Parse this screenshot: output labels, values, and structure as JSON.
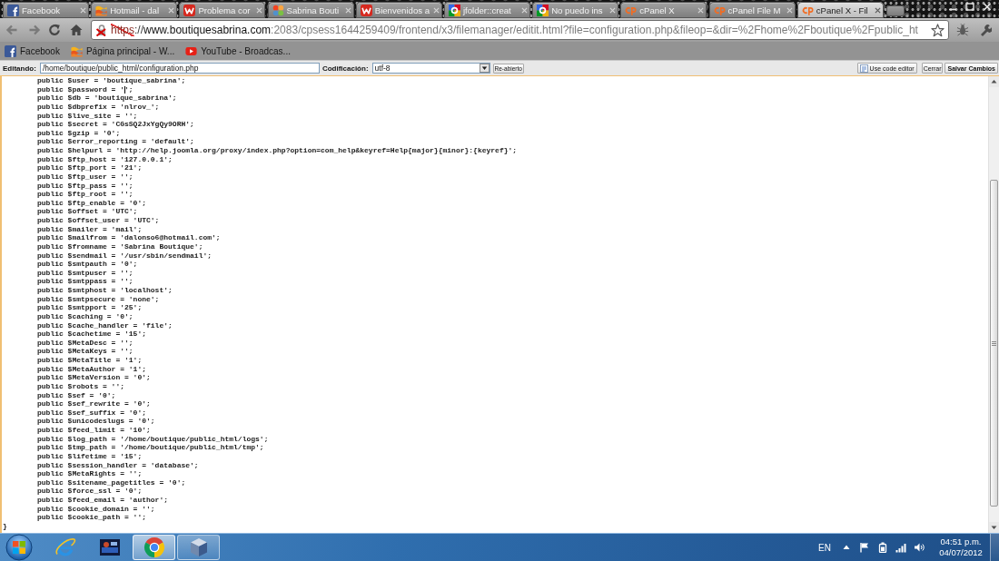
{
  "browser": {
    "tabs": [
      {
        "title": "Facebook",
        "kind": "facebook",
        "selected": false
      },
      {
        "title": "Hotmail - dal",
        "kind": "hotmail",
        "selected": false
      },
      {
        "title": "Problema cor",
        "kind": "w",
        "selected": false
      },
      {
        "title": "Sabrina Bouti",
        "kind": "joomla",
        "selected": false
      },
      {
        "title": "Bienvenidos a",
        "kind": "w",
        "selected": false
      },
      {
        "title": "jfolder::creat",
        "kind": "google",
        "selected": false
      },
      {
        "title": "No puedo ins",
        "kind": "google",
        "selected": false
      },
      {
        "title": "cPanel X",
        "kind": "cpanel",
        "selected": false
      },
      {
        "title": "cPanel File M",
        "kind": "cpanel",
        "selected": false
      },
      {
        "title": "cPanel X - Fil",
        "kind": "cpanel",
        "selected": true
      }
    ],
    "certificate_error": true,
    "url": {
      "scheme": "https",
      "separator": "://",
      "host": "www.boutiquesabrina.com",
      "path": ":2083/cpsess1644259409/frontend/x3/filemanager/editit.html?file=configuration.php&fileop=&dir=%2Fhome%2Fboutique%2Fpublic_ht"
    },
    "bookmarks": [
      {
        "label": "Facebook",
        "kind": "facebook"
      },
      {
        "label": "Página principal - W...",
        "kind": "hotmail"
      },
      {
        "label": "YouTube - Broadcas...",
        "kind": "youtube"
      }
    ]
  },
  "editor": {
    "path_label": "Editando:",
    "path": "/home/boutique/public_html/configuration.php",
    "encoding_label": "Codificación:",
    "encoding": "utf-8",
    "reopen_button": "Re-abierto",
    "code_editor_button": "Use code editor",
    "close_button": "Cerrar",
    "save_button": "Salvar Cambios",
    "lines": [
      {
        "text": "public $user = 'boutique_sabrina';",
        "cursor": false
      },
      {
        "text": "public $password = '",
        "cursor": true,
        "text_after_cursor": "';"
      },
      {
        "text": "public $db = 'boutique_sabrina';",
        "cursor": false
      },
      {
        "text": "public $dbprefix = 'nlrov_';",
        "cursor": false
      },
      {
        "text": "public $live_site = '';",
        "cursor": false
      },
      {
        "text": "public $secret = 'CGsSQ2JxYgQy9ORH';",
        "cursor": false
      },
      {
        "text": "public $gzip = '0';",
        "cursor": false
      },
      {
        "text": "public $error_reporting = 'default';",
        "cursor": false
      },
      {
        "text": "public $helpurl = 'http://help.joomla.org/proxy/index.php?option=com_help&keyref=Help{major}{minor}:{keyref}';",
        "cursor": false
      },
      {
        "text": "public $ftp_host = '127.0.0.1';",
        "cursor": false
      },
      {
        "text": "public $ftp_port = '21';",
        "cursor": false
      },
      {
        "text": "public $ftp_user = '';",
        "cursor": false
      },
      {
        "text": "public $ftp_pass = '';",
        "cursor": false
      },
      {
        "text": "public $ftp_root = '';",
        "cursor": false
      },
      {
        "text": "public $ftp_enable = '0';",
        "cursor": false
      },
      {
        "text": "public $offset = 'UTC';",
        "cursor": false
      },
      {
        "text": "public $offset_user = 'UTC';",
        "cursor": false
      },
      {
        "text": "public $mailer = 'mail';",
        "cursor": false
      },
      {
        "text": "public $mailfrom = 'dalonso6@hotmail.com';",
        "cursor": false
      },
      {
        "text": "public $fromname = 'Sabrina Boutique';",
        "cursor": false
      },
      {
        "text": "public $sendmail = '/usr/sbin/sendmail';",
        "cursor": false
      },
      {
        "text": "public $smtpauth = '0';",
        "cursor": false
      },
      {
        "text": "public $smtpuser = '';",
        "cursor": false
      },
      {
        "text": "public $smtppass = '';",
        "cursor": false
      },
      {
        "text": "public $smtphost = 'localhost';",
        "cursor": false
      },
      {
        "text": "public $smtpsecure = 'none';",
        "cursor": false
      },
      {
        "text": "public $smtpport = '25';",
        "cursor": false
      },
      {
        "text": "public $caching = '0';",
        "cursor": false
      },
      {
        "text": "public $cache_handler = 'file';",
        "cursor": false
      },
      {
        "text": "public $cachetime = '15';",
        "cursor": false
      },
      {
        "text": "public $MetaDesc = '';",
        "cursor": false
      },
      {
        "text": "public $MetaKeys = '';",
        "cursor": false
      },
      {
        "text": "public $MetaTitle = '1';",
        "cursor": false
      },
      {
        "text": "public $MetaAuthor = '1';",
        "cursor": false
      },
      {
        "text": "public $MetaVersion = '0';",
        "cursor": false
      },
      {
        "text": "public $robots = '';",
        "cursor": false
      },
      {
        "text": "public $sef = '0';",
        "cursor": false
      },
      {
        "text": "public $sef_rewrite = '0';",
        "cursor": false
      },
      {
        "text": "public $sef_suffix = '0';",
        "cursor": false
      },
      {
        "text": "public $unicodeslugs = '0';",
        "cursor": false
      },
      {
        "text": "public $feed_limit = '10';",
        "cursor": false
      },
      {
        "text": "public $log_path = '/home/boutique/public_html/logs';",
        "cursor": false
      },
      {
        "text": "public $tmp_path = '/home/boutique/public_html/tmp';",
        "cursor": false
      },
      {
        "text": "public $lifetime = '15';",
        "cursor": false
      },
      {
        "text": "public $session_handler = 'database';",
        "cursor": false
      },
      {
        "text": "public $MetaRights = '';",
        "cursor": false
      },
      {
        "text": "public $sitename_pagetitles = '0';",
        "cursor": false
      },
      {
        "text": "public $force_ssl = '0';",
        "cursor": false
      },
      {
        "text": "public $feed_email = 'author';",
        "cursor": false
      },
      {
        "text": "public $cookie_domain = '';",
        "cursor": false
      },
      {
        "text": "public $cookie_path = '';",
        "cursor": false
      }
    ],
    "closing_line": "}"
  },
  "taskbar": {
    "apps": [
      {
        "kind": "ie",
        "open": false,
        "selected": false
      },
      {
        "kind": "game",
        "open": false,
        "selected": false
      },
      {
        "kind": "chrome",
        "open": true,
        "selected": true
      },
      {
        "kind": "virtualbox",
        "open": true,
        "selected": false
      }
    ],
    "language": "EN",
    "time": "04:51 p.m.",
    "date": "04/07/2012"
  }
}
